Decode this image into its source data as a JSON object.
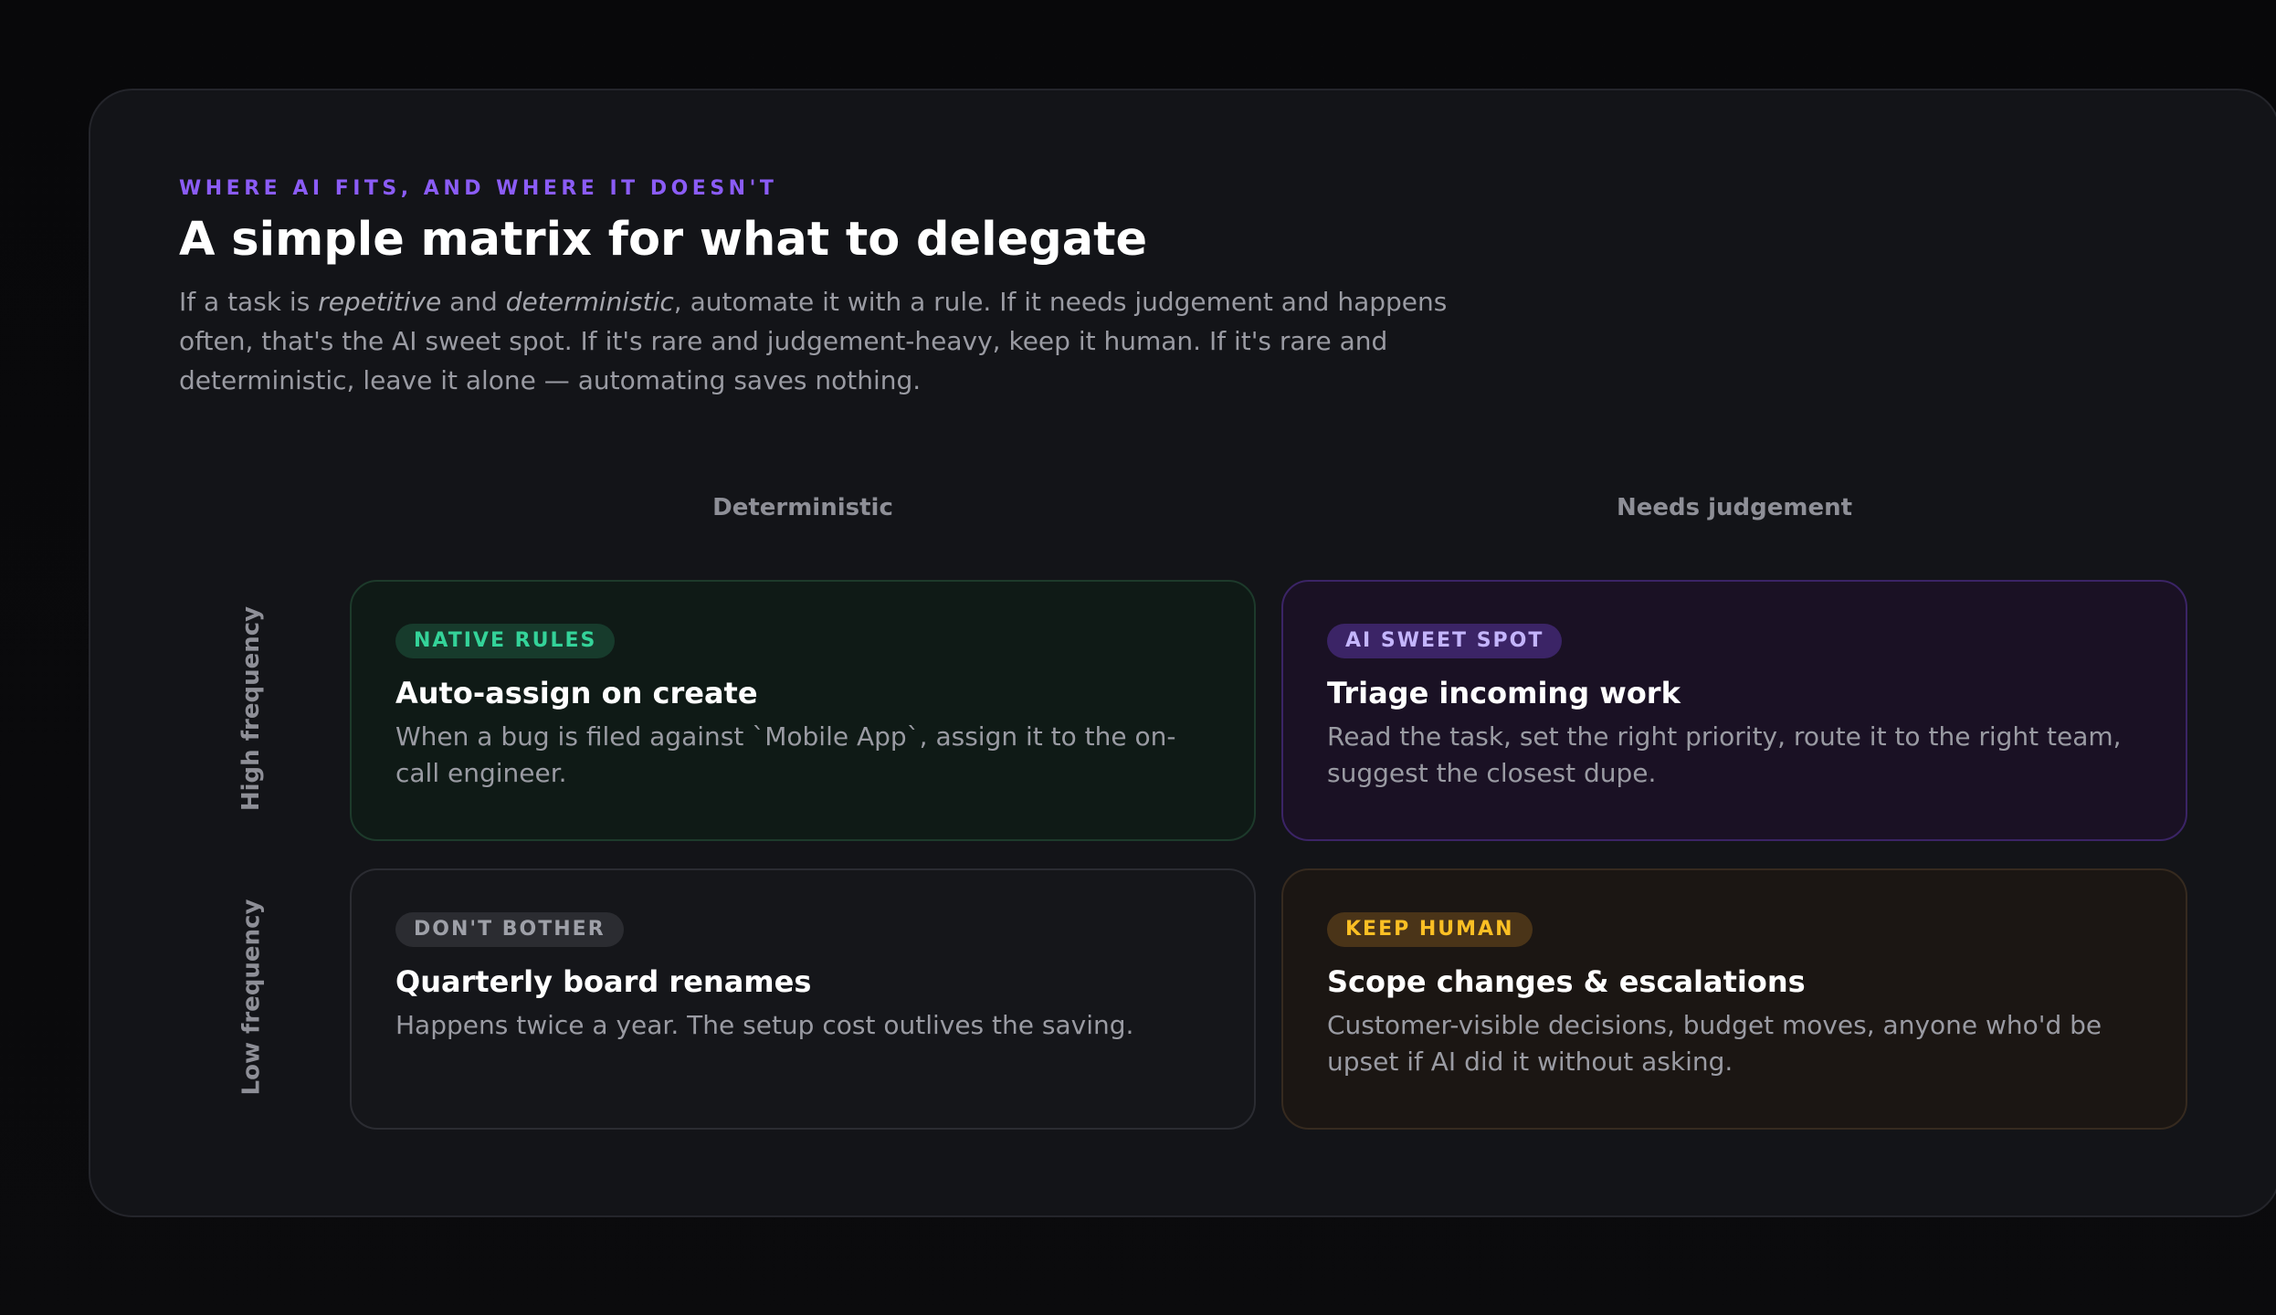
{
  "header": {
    "eyebrow": "WHERE AI FITS, AND WHERE IT DOESN'T",
    "title": "A simple matrix for what to delegate",
    "intro": {
      "p1": "If a task is ",
      "em1": "repetitive",
      "p2": " and ",
      "em2": "deterministic",
      "p3": ", automate it with a rule. If it needs judgement and happens often, that's the AI sweet spot. If it's rare and judgement-heavy, keep it human. If it's rare and deterministic, leave it alone — automating saves nothing."
    }
  },
  "columns": [
    "Deterministic",
    "Needs judgement"
  ],
  "rows": [
    "High frequency",
    "Low frequency"
  ],
  "cells": [
    {
      "badge": "NATIVE RULES",
      "title": "Auto-assign on create",
      "body": "When a bug is filed against `Mobile App`, assign it to the on-call engineer.",
      "tone": "green"
    },
    {
      "badge": "AI SWEET SPOT",
      "title": "Triage incoming work",
      "body": "Read the task, set the right priority, route it to the right team, suggest the closest dupe.",
      "tone": "purple"
    },
    {
      "badge": "DON'T BOTHER",
      "title": "Quarterly board renames",
      "body": "Happens twice a year. The setup cost outlives the saving.",
      "tone": "grey"
    },
    {
      "badge": "KEEP HUMAN",
      "title": "Scope changes & escalations",
      "body": "Customer-visible decisions, budget moves, anyone who'd be upset if AI did it without asking.",
      "tone": "amber"
    }
  ],
  "colors": {
    "accent": "#8b5cf6",
    "native_rules": "#34d399",
    "ai_sweet_spot": "#c4b5fd",
    "dont_bother": "#9ea0a8",
    "keep_human": "#fbbf24"
  }
}
